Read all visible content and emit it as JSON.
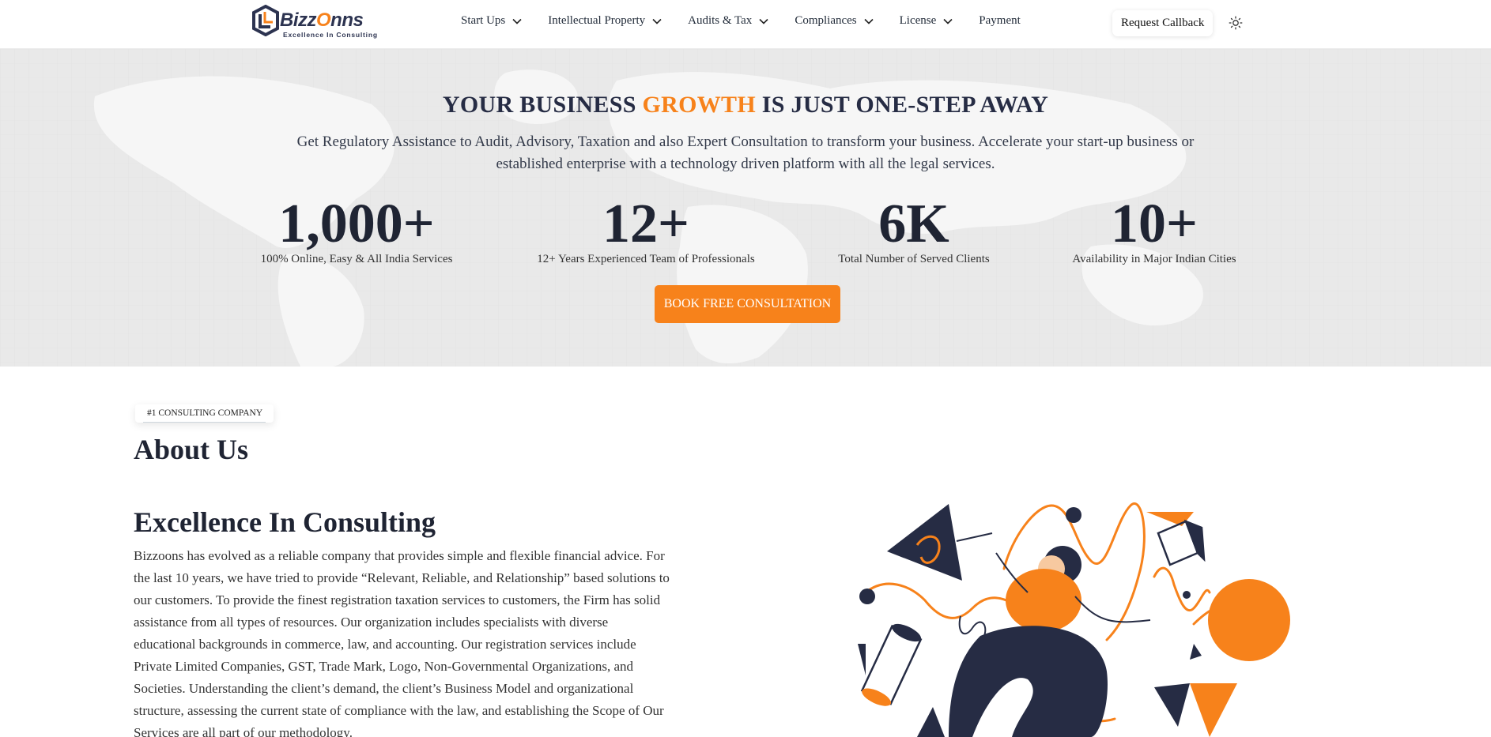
{
  "brand": {
    "name_start": "Bizz",
    "name_accent": "O",
    "name_end": "nns",
    "tagline": "Excellence In Consulting",
    "accent_color": "#f7821b",
    "dark_color": "#262c44"
  },
  "nav": {
    "items": [
      {
        "label": "Start Ups",
        "icon": "chevron-down-icon"
      },
      {
        "label": "Intellectual Property",
        "icon": "chevron-down-icon"
      },
      {
        "label": "Audits & Tax",
        "icon": "chevron-down-icon"
      },
      {
        "label": "Compliances",
        "icon": "chevron-down-icon"
      },
      {
        "label": "License",
        "icon": "chevron-down-icon"
      },
      {
        "label": "Payment"
      }
    ],
    "callback_label": "Request Callback",
    "theme_icon": "sun-icon"
  },
  "hero": {
    "title_start": "YOUR BUSINESS ",
    "title_accent": "GROWTH",
    "title_end": "  IS JUST ONE-STEP AWAY",
    "subtitle": "Get Regulatory Assistance to Audit, Advisory, Taxation and also Expert Consultation to transform your business. Accelerate your start-up business or established enterprise with a technology driven platform with all the legal services.",
    "stats": [
      {
        "value": "1,000+",
        "label": "100% Online, Easy & All India Services"
      },
      {
        "value": "12+",
        "label": "12+ Years Experienced Team of Professionals"
      },
      {
        "value": "6K",
        "label": "Total Number of Served Clients"
      },
      {
        "value": "10+",
        "label": "Availability in Major Indian Cities"
      }
    ],
    "cta_label": "BOOK FREE CONSULTATION"
  },
  "about": {
    "badge": "#1 CONSULTING COMPANY",
    "title": "About Us",
    "heading": "Excellence In Consulting",
    "body": "Bizzoons has evolved as a reliable company that provides simple and flexible financial advice. For the last 10 years, we have tried to provide “Relevant, Reliable, and Relationship” based solutions to our customers. To provide the finest registration taxation services to customers, the Firm has solid assistance from all types of resources. Our organization includes specialists with diverse educational backgrounds in commerce, law, and accounting. Our registration services include Private Limited Companies, GST, Trade Mark, Logo, Non-Governmental Organizations, and Societies. Understanding the client’s demand, the client’s Business Model and organizational structure, assessing the current state of compliance with the law, and establishing the Scope of Our Services are all part of our methodology.",
    "illustration": "consulting-illustration"
  }
}
